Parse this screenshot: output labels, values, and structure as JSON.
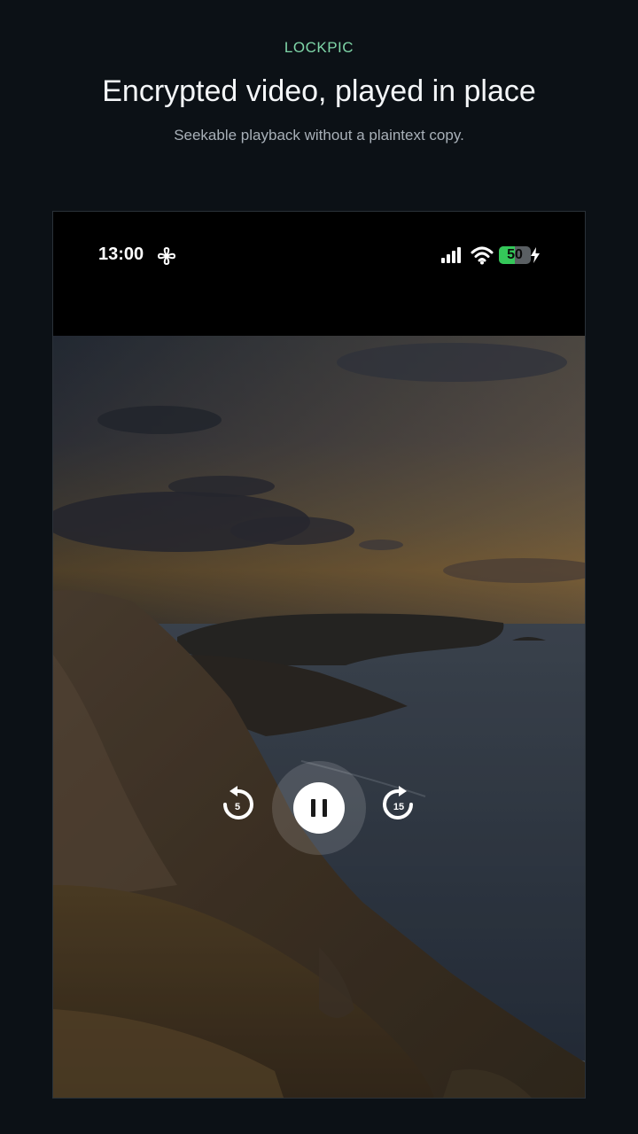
{
  "promo": {
    "brand": "LOCKPIC",
    "headline": "Encrypted video, played in place",
    "subline": "Seekable playback without a plaintext copy."
  },
  "status_bar": {
    "time": "13:00",
    "battery_level": "50",
    "battery_fraction": 0.5,
    "icons": [
      "fan-icon",
      "signal-icon",
      "wifi-icon",
      "battery-icon",
      "charging-bolt-icon"
    ]
  },
  "player": {
    "state": "playing",
    "rewind_seconds": "5",
    "forward_seconds": "15",
    "icons": [
      "rewind-icon",
      "pause-icon",
      "forward-icon"
    ]
  },
  "colors": {
    "background": "#0c1116",
    "brand": "#7fd6a8",
    "battery": "#34c759"
  }
}
